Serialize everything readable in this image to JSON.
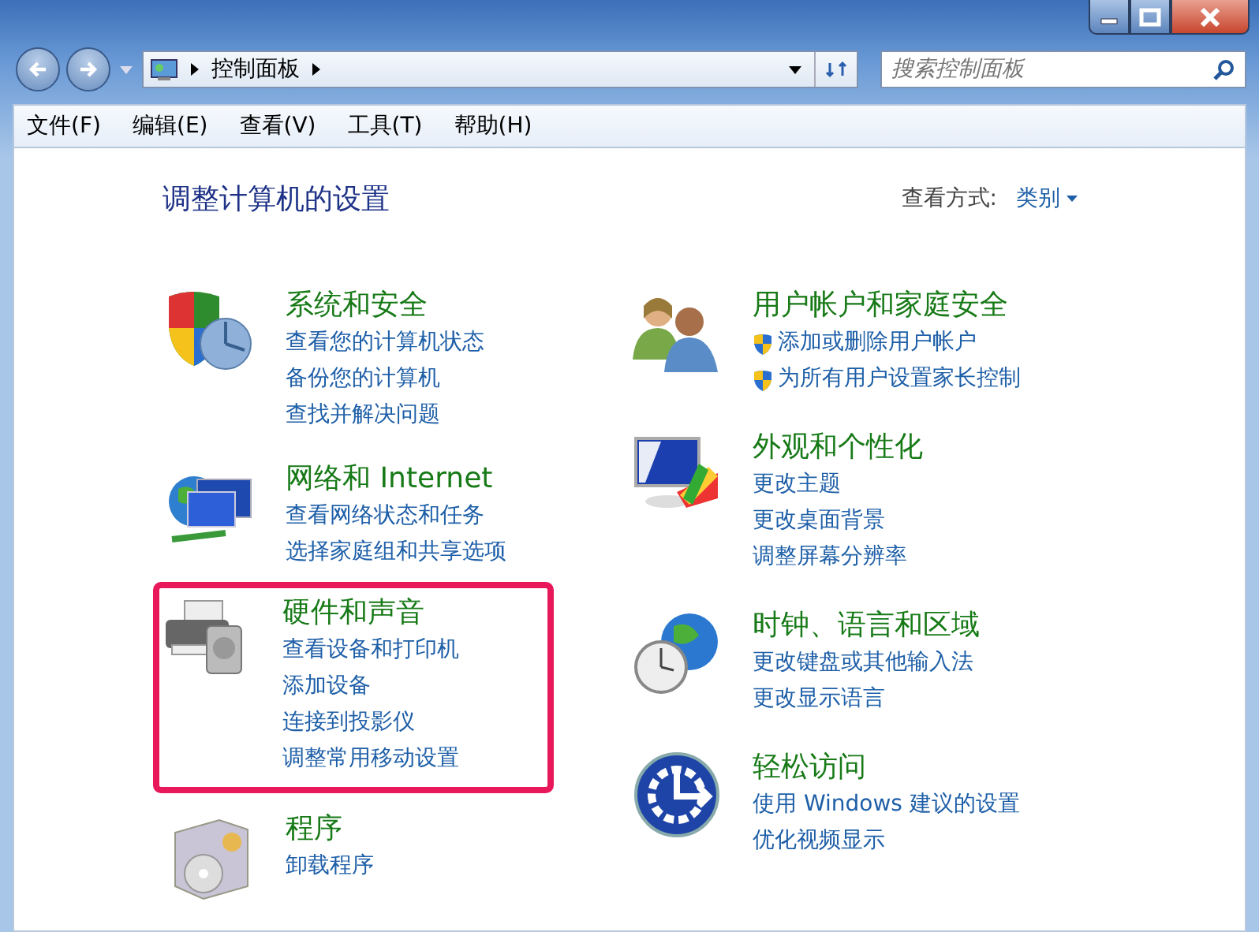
{
  "address_bar": {
    "path": [
      "控制面板"
    ],
    "search_placeholder": "搜索控制面板"
  },
  "menu": [
    "文件(F)",
    "编辑(E)",
    "查看(V)",
    "工具(T)",
    "帮助(H)"
  ],
  "heading": "调整计算机的设置",
  "view_by": {
    "label": "查看方式:",
    "value": "类别"
  },
  "columns": [
    [
      {
        "kind": "security",
        "title": "系统和安全",
        "highlighted": false,
        "links": [
          {
            "text": "查看您的计算机状态",
            "shield": false
          },
          {
            "text": "备份您的计算机",
            "shield": false
          },
          {
            "text": "查找并解决问题",
            "shield": false
          }
        ]
      },
      {
        "kind": "network",
        "title": "网络和 Internet",
        "highlighted": false,
        "links": [
          {
            "text": "查看网络状态和任务",
            "shield": false
          },
          {
            "text": "选择家庭组和共享选项",
            "shield": false
          }
        ]
      },
      {
        "kind": "hardware",
        "title": "硬件和声音",
        "highlighted": true,
        "links": [
          {
            "text": "查看设备和打印机",
            "shield": false
          },
          {
            "text": "添加设备",
            "shield": false
          },
          {
            "text": "连接到投影仪",
            "shield": false
          },
          {
            "text": "调整常用移动设置",
            "shield": false
          }
        ]
      },
      {
        "kind": "programs",
        "title": "程序",
        "highlighted": false,
        "links": [
          {
            "text": "卸载程序",
            "shield": false
          }
        ]
      }
    ],
    [
      {
        "kind": "users",
        "title": "用户帐户和家庭安全",
        "highlighted": false,
        "links": [
          {
            "text": "添加或删除用户帐户",
            "shield": true
          },
          {
            "text": "为所有用户设置家长控制",
            "shield": true
          }
        ]
      },
      {
        "kind": "appearance",
        "title": "外观和个性化",
        "highlighted": false,
        "links": [
          {
            "text": "更改主题",
            "shield": false
          },
          {
            "text": "更改桌面背景",
            "shield": false
          },
          {
            "text": "调整屏幕分辨率",
            "shield": false
          }
        ]
      },
      {
        "kind": "clock",
        "title": "时钟、语言和区域",
        "highlighted": false,
        "links": [
          {
            "text": "更改键盘或其他输入法",
            "shield": false
          },
          {
            "text": "更改显示语言",
            "shield": false
          }
        ]
      },
      {
        "kind": "access",
        "title": "轻松访问",
        "highlighted": false,
        "links": [
          {
            "text": "使用 Windows 建议的设置",
            "shield": false
          },
          {
            "text": "优化视频显示",
            "shield": false
          }
        ]
      }
    ]
  ]
}
